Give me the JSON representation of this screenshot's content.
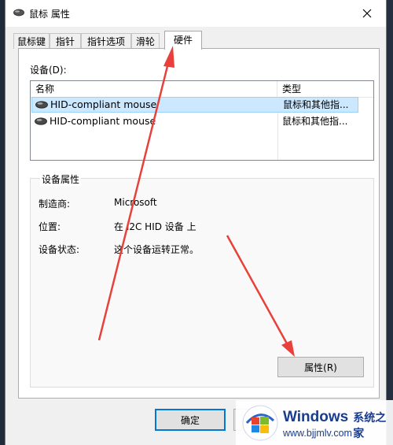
{
  "window": {
    "title": "鼠标 属性"
  },
  "tabs": [
    {
      "label": "鼠标键"
    },
    {
      "label": "指针"
    },
    {
      "label": "指针选项"
    },
    {
      "label": "滑轮"
    },
    {
      "label": "硬件"
    }
  ],
  "hardware": {
    "devices_label": "设备(D):",
    "columns": {
      "name": "名称",
      "type": "类型"
    },
    "devices": [
      {
        "name": "HID-compliant mouse",
        "type": "鼠标和其他指..."
      },
      {
        "name": "HID-compliant mouse",
        "type": "鼠标和其他指..."
      }
    ],
    "properties": {
      "group_title": "设备属性",
      "manufacturer_label": "制造商:",
      "manufacturer_value": "Microsoft",
      "location_label": "位置:",
      "location_value": "在 I2C HID 设备 上",
      "status_label": "设备状态:",
      "status_value": "这个设备运转正常。",
      "button_label": "属性(R)"
    }
  },
  "footer": {
    "ok_label": "确定"
  },
  "watermark": {
    "brand": "Windows",
    "brand_cn": "系统之家",
    "url": "www.bjjmlv.com"
  },
  "colors": {
    "accent": "#0078d7",
    "selection": "#cce8ff",
    "annotation_arrow": "#e8403a",
    "watermark_text": "#1a3c8f"
  },
  "icons": {
    "mouse": "mouse-icon",
    "close": "close-icon"
  }
}
